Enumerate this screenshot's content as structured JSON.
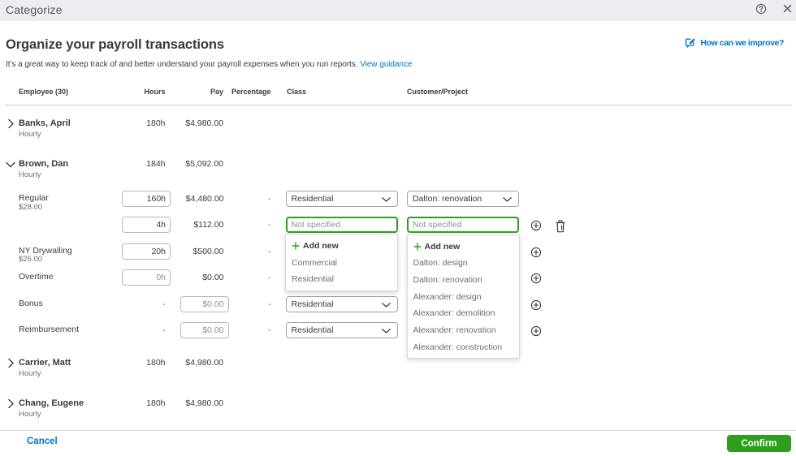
{
  "titlebar": {
    "title": "Categorize"
  },
  "intro": {
    "heading": "Organize your payroll transactions",
    "description": "It’s a great way to keep track of and better understand your payroll expenses when you run reports.",
    "guidance_link": "View guidance",
    "feedback_link": "How can we improve?"
  },
  "columns": {
    "employee": "Employee (30)",
    "hours": "Hours",
    "pay": "Pay",
    "percentage": "Percentage",
    "class": "Class",
    "customer": "Customer/Project"
  },
  "employees": [
    {
      "name": "Banks, April",
      "type": "Hourly",
      "hours": "180h",
      "pay": "$4,980.00",
      "expanded": false
    },
    {
      "name": "Brown, Dan",
      "type": "Hourly",
      "hours": "184h",
      "pay": "$5,092.00",
      "expanded": true
    },
    {
      "name": "Carrier, Matt",
      "type": "Hourly",
      "hours": "180h",
      "pay": "$4,980.00",
      "expanded": false
    },
    {
      "name": "Chang, Eugene",
      "type": "Hourly",
      "hours": "180h",
      "pay": "$4,980.00",
      "expanded": false
    }
  ],
  "payrows": [
    {
      "label": "Regular",
      "rate": "$28.00",
      "hours": "160h",
      "pay": "$4,480.00",
      "pct": "-",
      "class_value": "Residential",
      "customer_value": "Dalton: renovation"
    },
    {
      "hours": "4h",
      "pay": "$112.00",
      "pct": "-",
      "class_placeholder": "Not specified",
      "customer_placeholder": "Not specified"
    },
    {
      "label": "NY Drywalling",
      "rate": "$25.00",
      "hours": "20h",
      "pay": "$500.00",
      "pct": "-"
    },
    {
      "label": "Overtime",
      "hours_placeholder": "0h",
      "pay": "$0.00",
      "pct": "-"
    },
    {
      "label": "Bonus",
      "hours": "-",
      "pay_placeholder": "$0.00",
      "pct": "-",
      "class_value": "Residential"
    },
    {
      "label": "Reimbursement",
      "hours": "-",
      "pay_placeholder": "$0.00",
      "pct": "-",
      "class_value": "Residential"
    }
  ],
  "class_dropdown": {
    "add_new": "Add new",
    "options": [
      "Commercial",
      "Residential"
    ]
  },
  "customer_dropdown": {
    "add_new": "Add new",
    "options": [
      "Dalton: design",
      "Dalton: renovation",
      "Alexander: design",
      "Alexander: demolition",
      "Alexander: renovation",
      "Alexander: construction"
    ]
  },
  "footer": {
    "cancel": "Cancel",
    "confirm": "Confirm"
  },
  "colors": {
    "green": "#2ca01c",
    "blue": "#0077c5",
    "text": "#393a3d",
    "muted": "#6b6c72",
    "titlebar_bg": "#ecedf0"
  }
}
